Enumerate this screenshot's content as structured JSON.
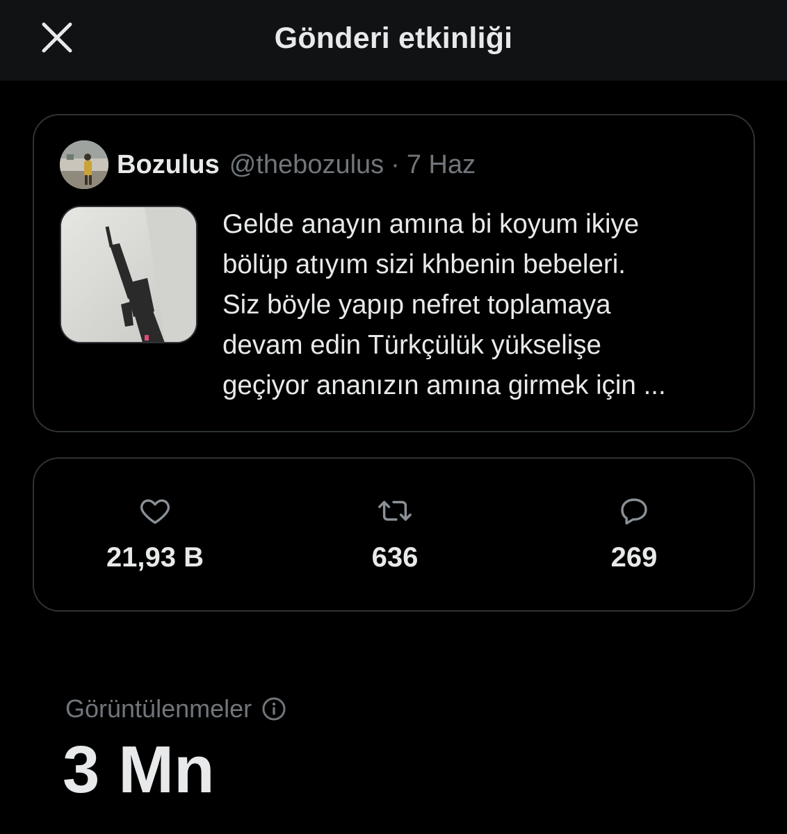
{
  "header": {
    "title": "Gönderi etkinliği",
    "close_icon": "close-icon"
  },
  "post": {
    "display_name": "Bozulus",
    "handle": "@thebozulus",
    "separator": "·",
    "date": "7 Haz",
    "text": "Gelde anayın amına bi koyum ikiye bölüp atıyım sizi khbenin bebeleri. Siz böyle yapıp nefret toplamaya devam edin Türkçülük yükselişe geçiyor ananızın amına girmek için ...",
    "text_lines": [
      "Gelde anayın amına bi koyum ikiye",
      "bölüp atıyım sizi khbenin bebeleri.",
      "Siz böyle yapıp nefret toplamaya",
      "devam edin Türkçülük yükselişe",
      "geçiyor ananızın amına girmek için ..."
    ]
  },
  "stats": {
    "likes": {
      "icon": "heart-icon",
      "value": "21,93 B"
    },
    "reposts": {
      "icon": "repost-icon",
      "value": "636"
    },
    "replies": {
      "icon": "reply-icon",
      "value": "269"
    }
  },
  "views": {
    "label": "Görüntülenmeler",
    "info_icon": "info-icon",
    "value": "3 Mn"
  },
  "colors": {
    "background": "#000000",
    "header_background": "#111213",
    "primary_text": "#e7e9ea",
    "secondary_text": "#71767b",
    "border": "#2f3336"
  }
}
